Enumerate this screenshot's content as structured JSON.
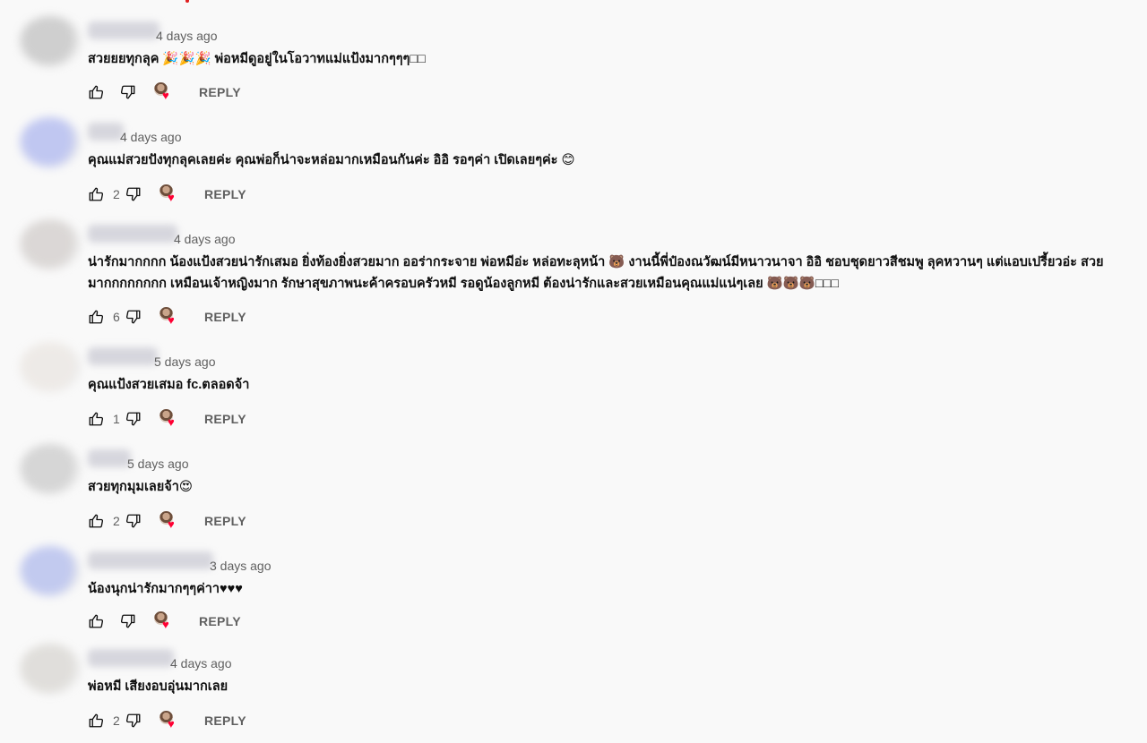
{
  "comments": [
    {
      "time": "4 days ago",
      "text": "สวยยยทุกลุค 🎉🎉🎉 พ่อหมีดูอยู่ในโอวาทแม่แป้งมากๆๆๆ□□",
      "like_count": "",
      "reply_label": "REPLY",
      "avatar_color": "#c8c8c8"
    },
    {
      "time": "4 days ago",
      "text": "คุณแม่สวยปังทุกลุคเลยค่ะ คุณพ่อก็น่าจะหล่อมากเหมือนกันค่ะ อิอิ รอๆค่า เปิดเลยๆค่ะ 😊",
      "like_count": "2",
      "reply_label": "REPLY",
      "avatar_color": "#b7bff0"
    },
    {
      "time": "4 days ago",
      "text": "น่ารักมากกกก น้องแป้งสวยน่ารักเสมอ ยิ่งท้องยิ่งสวยมาก ออร่ากระจาย พ่อหมีอ่ะ หล่อทะลุหน้า 🐻 งานนี้พี่ป๋องณวัฒน์มีหนาวนาจา อิอิ ชอบชุดยาวสีชมพู ลุคหวานๆ แต่แอบเปรี้ยวอ่ะ สวยมากกกกกกกก เหมือนเจ้าหญิงมาก รักษาสุขภาพนะค้าครอบครัวหมี รอดูน้องลูกหมี ต้องน่ารักและสวยเหมือนคุณแม่แน่ๆเลย 🐻🐻🐻□□□",
      "like_count": "6",
      "reply_label": "REPLY",
      "avatar_color": "#d6d2d0"
    },
    {
      "time": "5 days ago",
      "text": "คุณแป้งสวยเสมอ fc.ตลอดจ้า",
      "like_count": "1",
      "reply_label": "REPLY",
      "avatar_color": "#ece8e4"
    },
    {
      "time": "5 days ago",
      "text": "สวยทุกมุมเลยจ้า😍",
      "like_count": "2",
      "reply_label": "REPLY",
      "avatar_color": "#d0d0d0"
    },
    {
      "time": "3 days ago",
      "text": "น้องนุกน่ารักมากๆๆค่าา♥♥♥",
      "like_count": "",
      "reply_label": "REPLY",
      "avatar_color": "#b9c2ee"
    },
    {
      "time": "4 days ago",
      "text": "พ่อหมี เสียงอบอุ่นมากเลย",
      "like_count": "2",
      "reply_label": "REPLY",
      "avatar_color": "#dcdad6"
    }
  ],
  "icons": {
    "like": "thumbs-up-icon",
    "dislike": "thumbs-down-icon",
    "creator_heart": "creator-heart-icon"
  },
  "colors": {
    "background": "#f9f9f9",
    "meta_text": "#606060",
    "heart": "#ff0033"
  }
}
